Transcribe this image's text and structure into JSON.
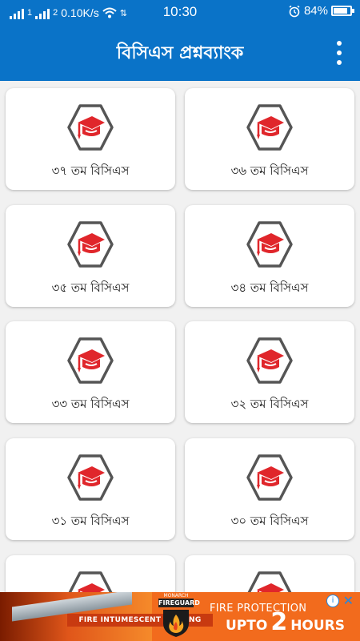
{
  "status_bar": {
    "sim1": "1",
    "sim2": "2",
    "network_speed": "0.10K/s",
    "time": "10:30",
    "battery_percent": "84%",
    "battery_level": 0.84
  },
  "app_bar": {
    "title": "বিসিএস প্রশ্নব্যাংক",
    "menu_icon": "more-vertical-icon"
  },
  "cards": [
    {
      "label": "৩৭ তম বিসিএস",
      "icon": "graduation-cap-icon"
    },
    {
      "label": "৩৬ তম বিসিএস",
      "icon": "graduation-cap-icon"
    },
    {
      "label": "৩৫ তম বিসিএস",
      "icon": "graduation-cap-icon"
    },
    {
      "label": "৩৪ তম বিসিএস",
      "icon": "graduation-cap-icon"
    },
    {
      "label": "৩৩ তম বিসিএস",
      "icon": "graduation-cap-icon"
    },
    {
      "label": "৩২ তম বিসিএস",
      "icon": "graduation-cap-icon"
    },
    {
      "label": "৩১ তম বিসিএস",
      "icon": "graduation-cap-icon"
    },
    {
      "label": "৩০ তম বিসিএস",
      "icon": "graduation-cap-icon"
    },
    {
      "label": "",
      "icon": "graduation-cap-icon"
    },
    {
      "label": "",
      "icon": "graduation-cap-icon"
    }
  ],
  "ad": {
    "brand_top": "MONARCH",
    "brand": "FIREGUARD",
    "strip": "FIRE INTUMESCENT COATING",
    "headline": "FIRE PROTECTION",
    "upto": "UPTO",
    "number": "2",
    "hours": "HOURS",
    "info_icon": "info-icon",
    "close_icon": "close-icon"
  },
  "colors": {
    "primary": "#0a73c8",
    "icon_red": "#e0262b",
    "icon_outline": "#555555",
    "ad_orange": "#f26b1d"
  }
}
